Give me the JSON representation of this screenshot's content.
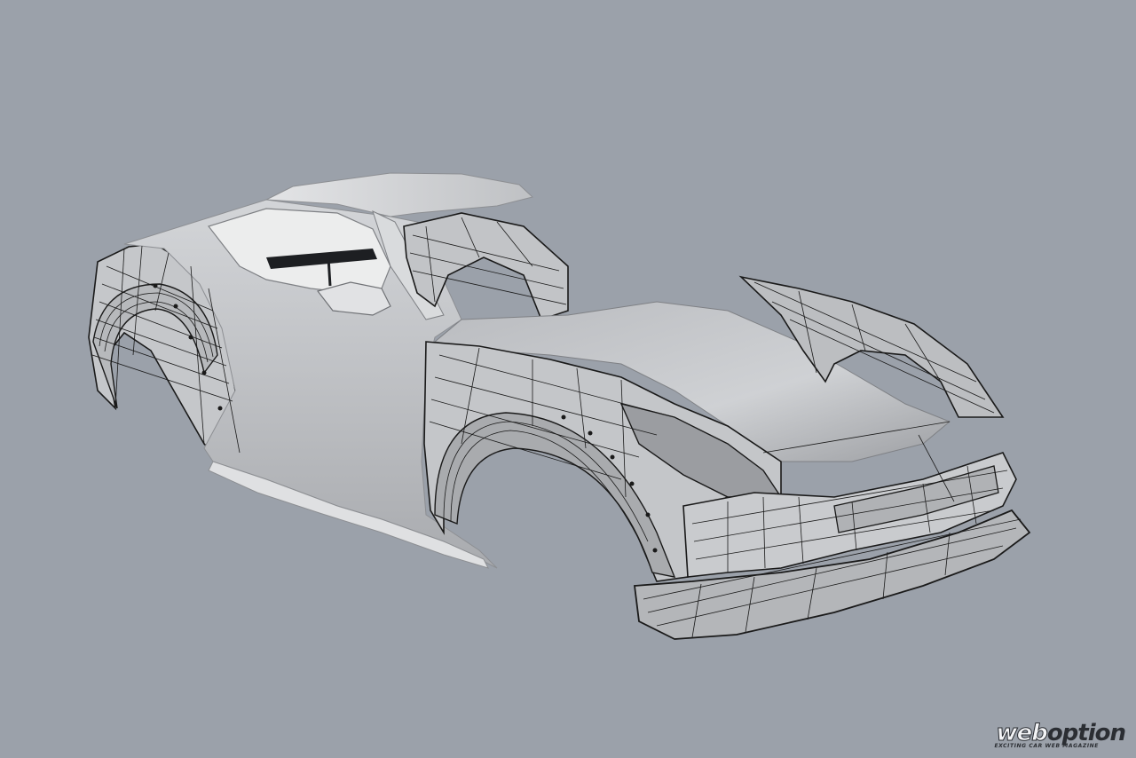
{
  "scene": {
    "subject": "car-body-cad-model",
    "background_color": "#9ba1aa",
    "body_color": "#d4d6d9",
    "wire_color": "#1a1a1a"
  },
  "watermark": {
    "logo_part1": "web",
    "logo_part2": "option",
    "tagline": "EXCITING CAR WEB MAGAZINE"
  }
}
